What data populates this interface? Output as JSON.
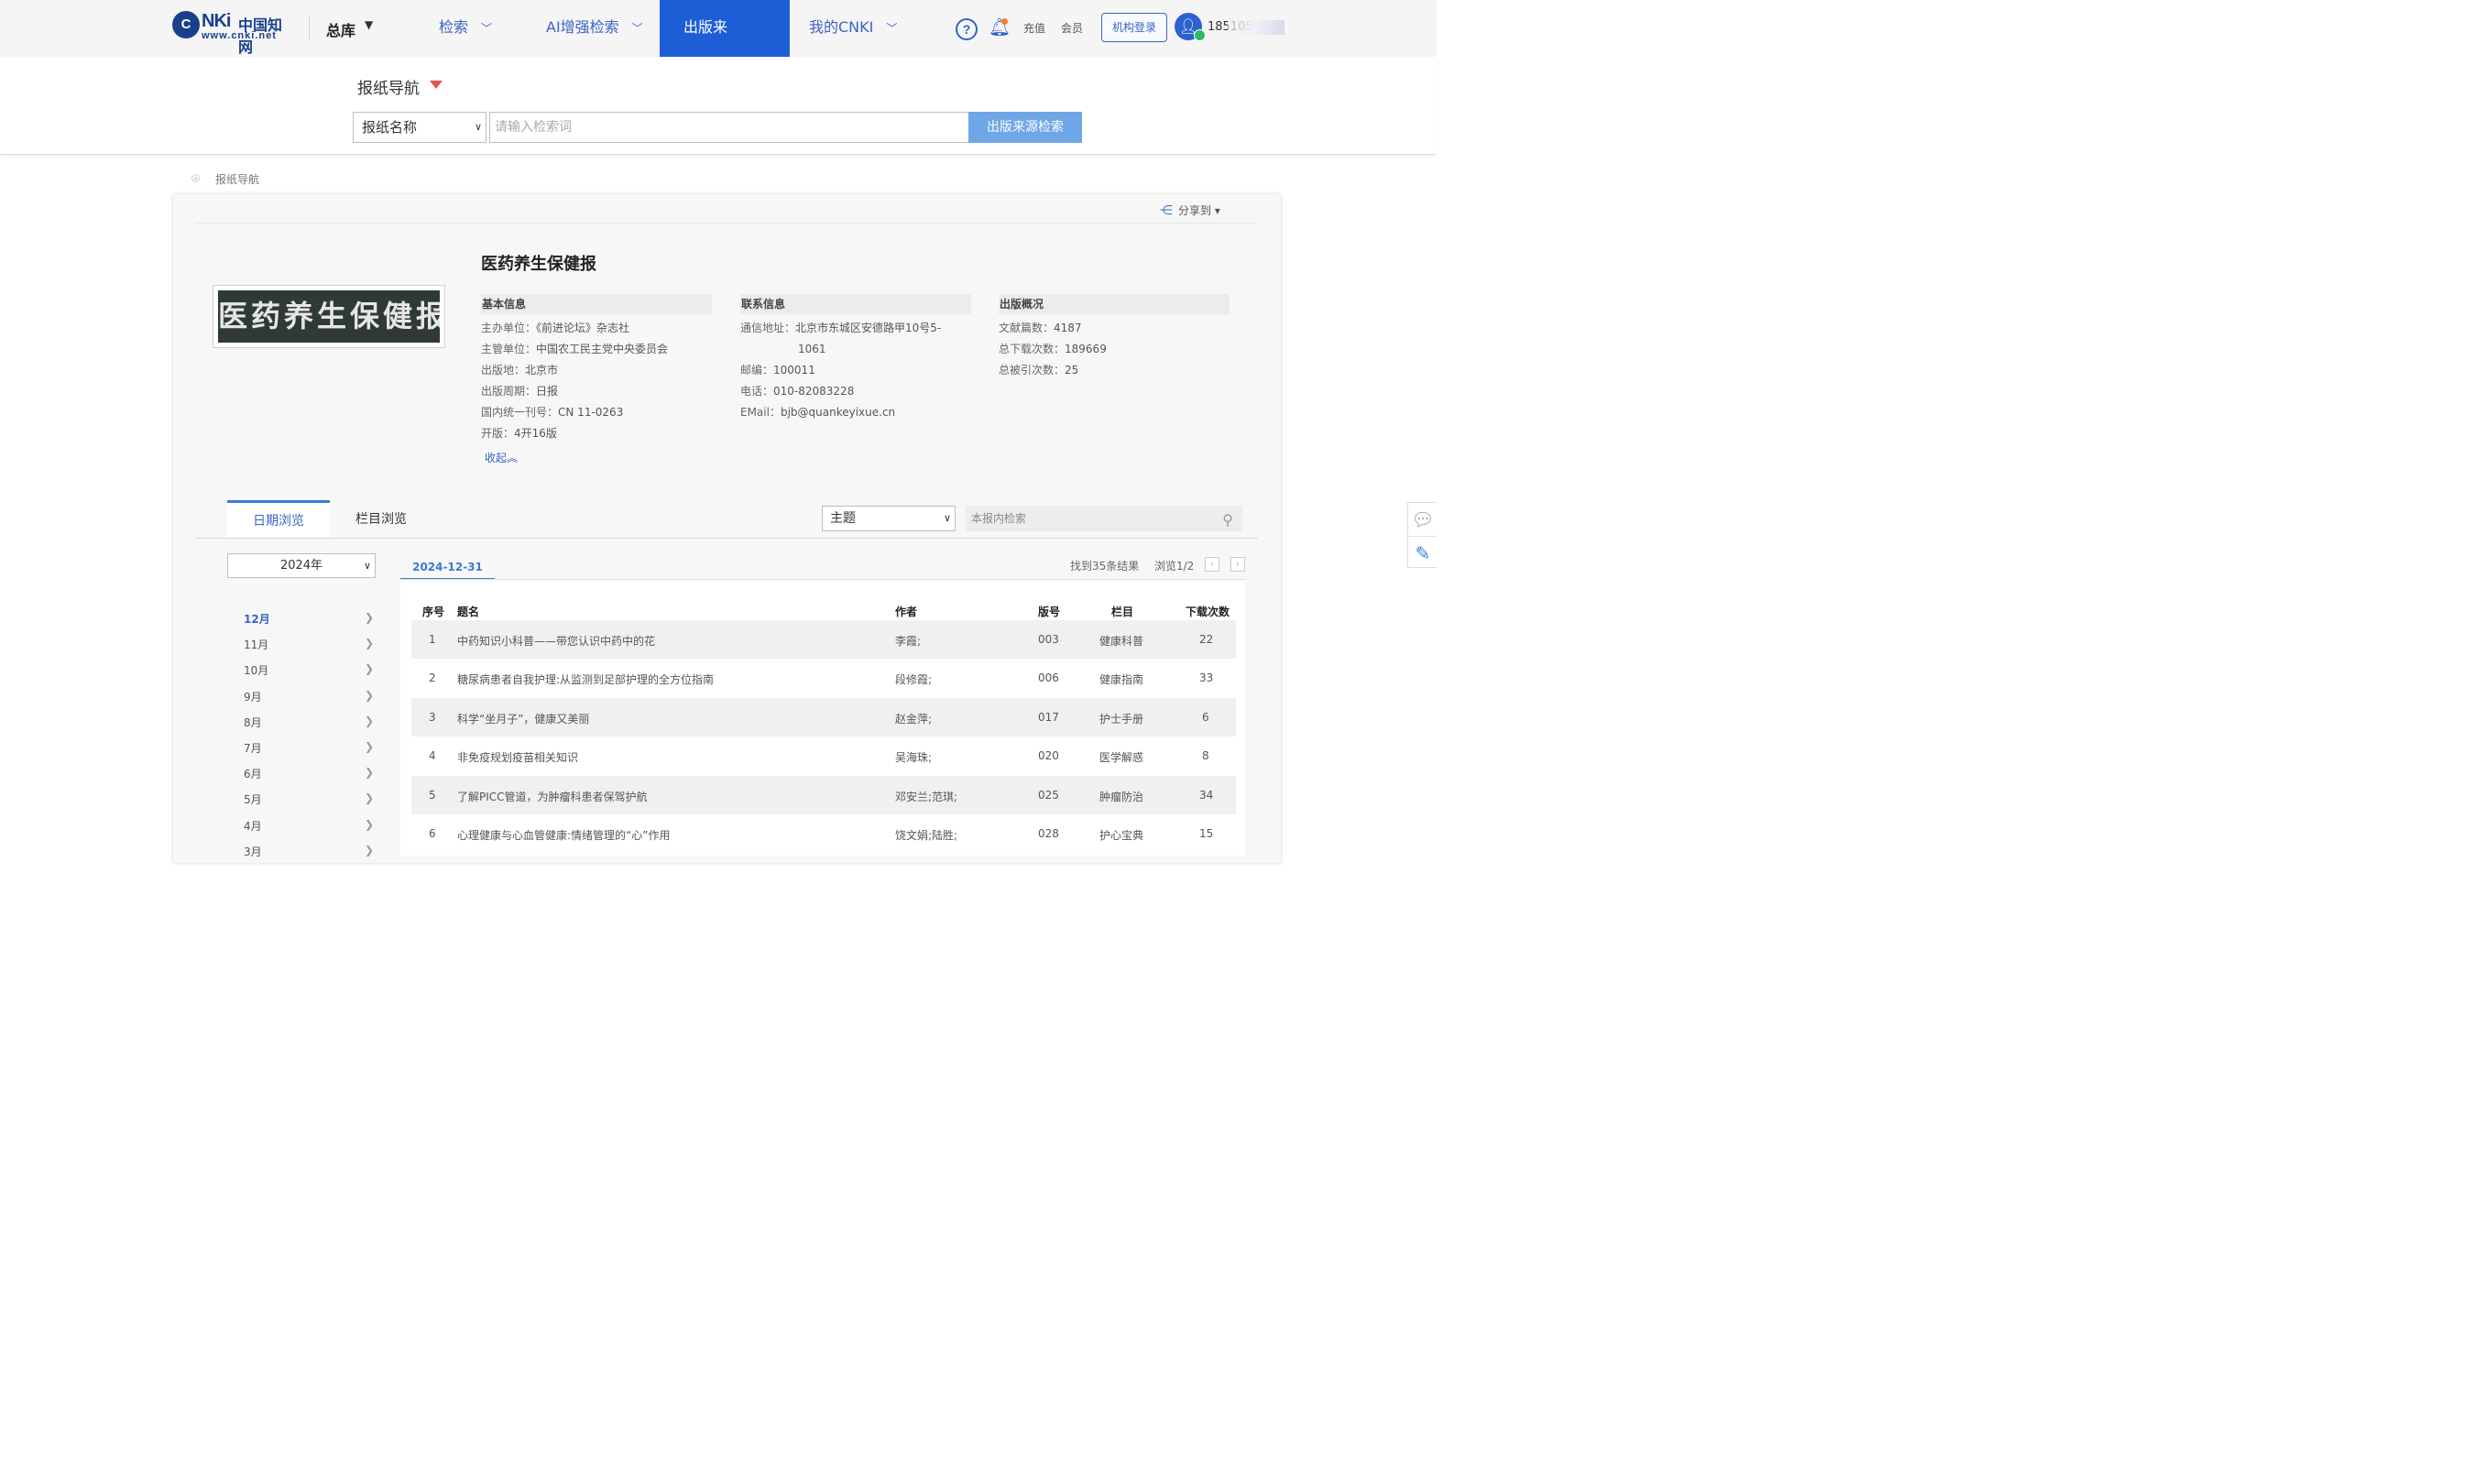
{
  "header": {
    "logo_badge": "C",
    "logo_brand": "NKi",
    "logo_cn": "中国知网",
    "logo_url": "www.cnki.net",
    "library": "总库",
    "nav": [
      "检索",
      "AI增强检索",
      "出版来源",
      "我的CNKI"
    ],
    "active_nav": "出版来源",
    "recharge": "充值",
    "member": "会员",
    "org_login": "机构登录",
    "username": "1851050"
  },
  "search": {
    "section_title": "报纸导航",
    "select_value": "报纸名称",
    "placeholder": "请输入检索词",
    "button": "出版来源检索"
  },
  "breadcrumb": "报纸导航",
  "share": "分享到",
  "paper": {
    "title": "医药养生保健报",
    "cover_text": "医药养生保健报",
    "basic": {
      "head": "基本信息",
      "rows": [
        {
          "k": "主办单位：",
          "v": "《前进论坛》杂志社"
        },
        {
          "k": "主管单位：",
          "v": "中国农工民主党中央委员会"
        },
        {
          "k": "出版地：",
          "v": "北京市"
        },
        {
          "k": "出版周期：",
          "v": "日报"
        },
        {
          "k": "国内统一刊号：",
          "v": "CN 11-0263"
        },
        {
          "k": "开版：",
          "v": "4开16版"
        }
      ]
    },
    "contact": {
      "head": "联系信息",
      "address_k": "通信地址：",
      "address_v1": "北京市东城区安德路甲10号5-",
      "address_v2": "1061",
      "rows": [
        {
          "k": "邮编：",
          "v": "100011"
        },
        {
          "k": "电话：",
          "v": "010-82083228"
        },
        {
          "k": "EMail：",
          "v": "bjb@quankeyixue.cn"
        }
      ]
    },
    "overview": {
      "head": "出版概况",
      "rows": [
        {
          "k": "文献篇数：",
          "v": "4187"
        },
        {
          "k": "总下载次数：",
          "v": "189669"
        },
        {
          "k": "总被引次数：",
          "v": "25"
        }
      ]
    },
    "collapse": "收起︽"
  },
  "tabs": {
    "date_browse": "日期浏览",
    "column_browse": "栏目浏览",
    "topic_select": "主题",
    "inner_search_placeholder": "本报内检索"
  },
  "browse": {
    "year": "2024年",
    "months": [
      "12月",
      "11月",
      "10月",
      "9月",
      "8月",
      "7月",
      "6月",
      "5月",
      "4月",
      "3月"
    ],
    "active_month": "12月",
    "date": "2024-12-31",
    "results": "找到35条结果",
    "page": "浏览1/2",
    "prev": "‹",
    "next": "›"
  },
  "table": {
    "headers": [
      "序号",
      "题名",
      "作者",
      "版号",
      "栏目",
      "下载次数"
    ],
    "rows": [
      {
        "no": "1",
        "title": "中药知识小科普——带您认识中药中的花",
        "author": "李霞;",
        "edition": "003",
        "column": "健康科普",
        "downloads": "22"
      },
      {
        "no": "2",
        "title": "糖尿病患者自我护理:从监测到足部护理的全方位指南",
        "author": "段修霞;",
        "edition": "006",
        "column": "健康指南",
        "downloads": "33"
      },
      {
        "no": "3",
        "title": "科学“坐月子”，健康又美丽",
        "author": "赵金萍;",
        "edition": "017",
        "column": "护士手册",
        "downloads": "6"
      },
      {
        "no": "4",
        "title": "非免疫规划疫苗相关知识",
        "author": "吴海珠;",
        "edition": "020",
        "column": "医学解惑",
        "downloads": "8"
      },
      {
        "no": "5",
        "title": "了解PICC管道，为肿瘤科患者保驾护航",
        "author": "邓安兰;范琪;",
        "edition": "025",
        "column": "肿瘤防治",
        "downloads": "34"
      },
      {
        "no": "6",
        "title": "心理健康与心血管健康:情绪管理的“心”作用",
        "author": "饶文娟;陆胜;",
        "edition": "028",
        "column": "护心宝典",
        "downloads": "15"
      }
    ]
  }
}
